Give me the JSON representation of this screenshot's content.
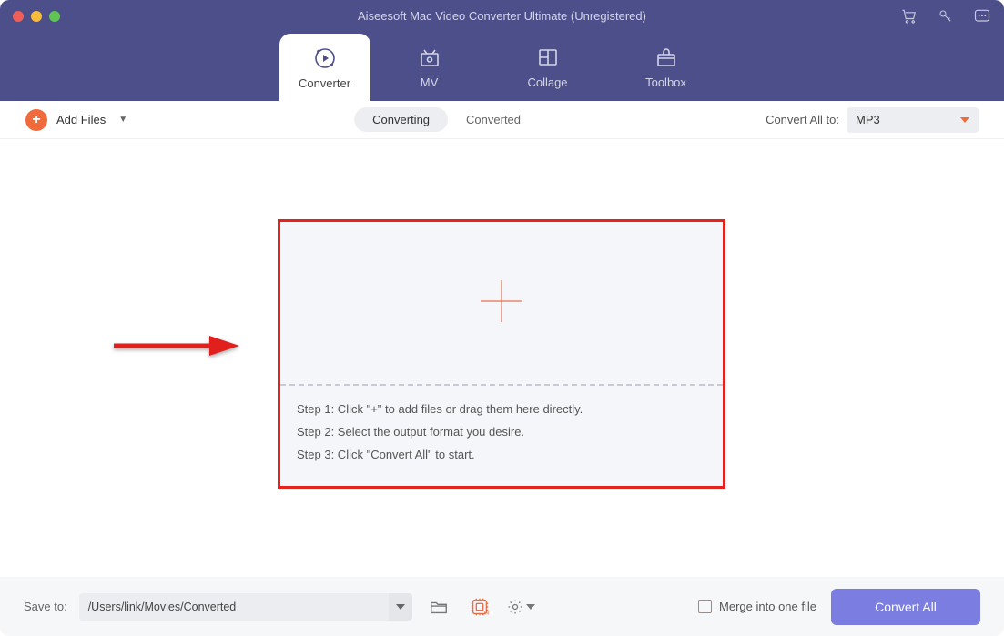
{
  "title": "Aiseesoft Mac Video Converter Ultimate (Unregistered)",
  "nav": {
    "converter": "Converter",
    "mv": "MV",
    "collage": "Collage",
    "toolbox": "Toolbox"
  },
  "toolbar": {
    "add_files": "Add Files",
    "seg_converting": "Converting",
    "seg_converted": "Converted",
    "convert_all_to_label": "Convert All to:",
    "format": "MP3"
  },
  "dropzone": {
    "step1": "Step 1: Click \"+\" to add files or drag them here directly.",
    "step2": "Step 2: Select the output format you desire.",
    "step3": "Step 3: Click \"Convert All\" to start."
  },
  "bottom": {
    "save_to_label": "Save to:",
    "path": "/Users/link/Movies/Converted",
    "merge_label": "Merge into one file",
    "convert_all_button": "Convert All"
  }
}
